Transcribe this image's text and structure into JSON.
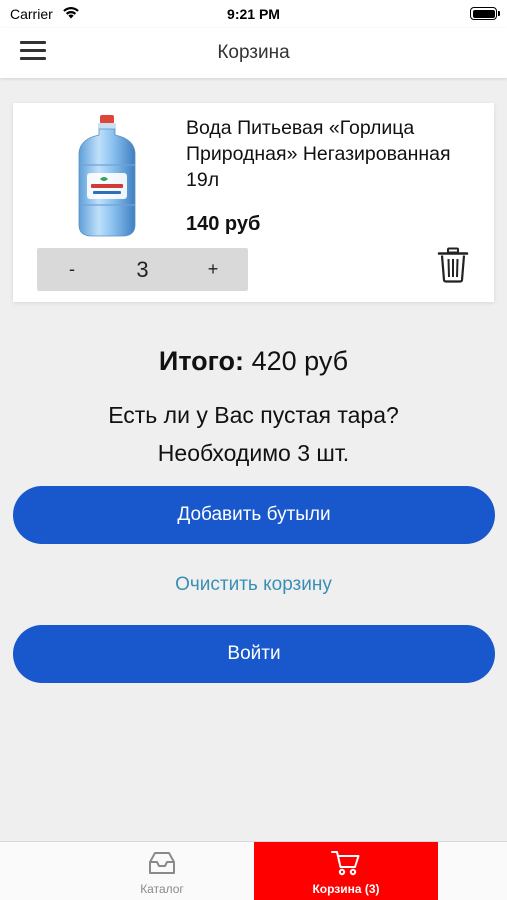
{
  "status_bar": {
    "carrier": "Carrier",
    "time": "9:21 PM",
    "wifi_icon": "wifi-icon",
    "battery_icon": "battery-icon"
  },
  "nav": {
    "title": "Корзина",
    "menu_icon": "hamburger-menu-icon"
  },
  "cart_item": {
    "name": "Вода Питьевая «Горлица Природная» Негазированная 19л",
    "price": "140 руб",
    "quantity": "3",
    "minus_label": "-",
    "plus_label": "+",
    "image": "water-bottle-image",
    "delete_icon": "trash-icon"
  },
  "summary": {
    "total_label": "Итого:",
    "total_value": "420 руб",
    "tara_question": "Есть ли у Вас пустая тара?",
    "tara_needed": "Необходимо 3 шт."
  },
  "actions": {
    "add_bottles": "Добавить бутыли",
    "clear_cart": "Очистить корзину",
    "login": "Войти"
  },
  "tabbar": {
    "tabs": [
      {
        "label": "Каталог",
        "icon": "inbox-icon",
        "active": false
      },
      {
        "label": "Корзина (3)",
        "icon": "cart-icon",
        "active": true
      }
    ]
  },
  "colors": {
    "primary_button": "#1857cc",
    "link": "#3a8fb7",
    "active_tab": "#ff0000",
    "background": "#efefef"
  }
}
